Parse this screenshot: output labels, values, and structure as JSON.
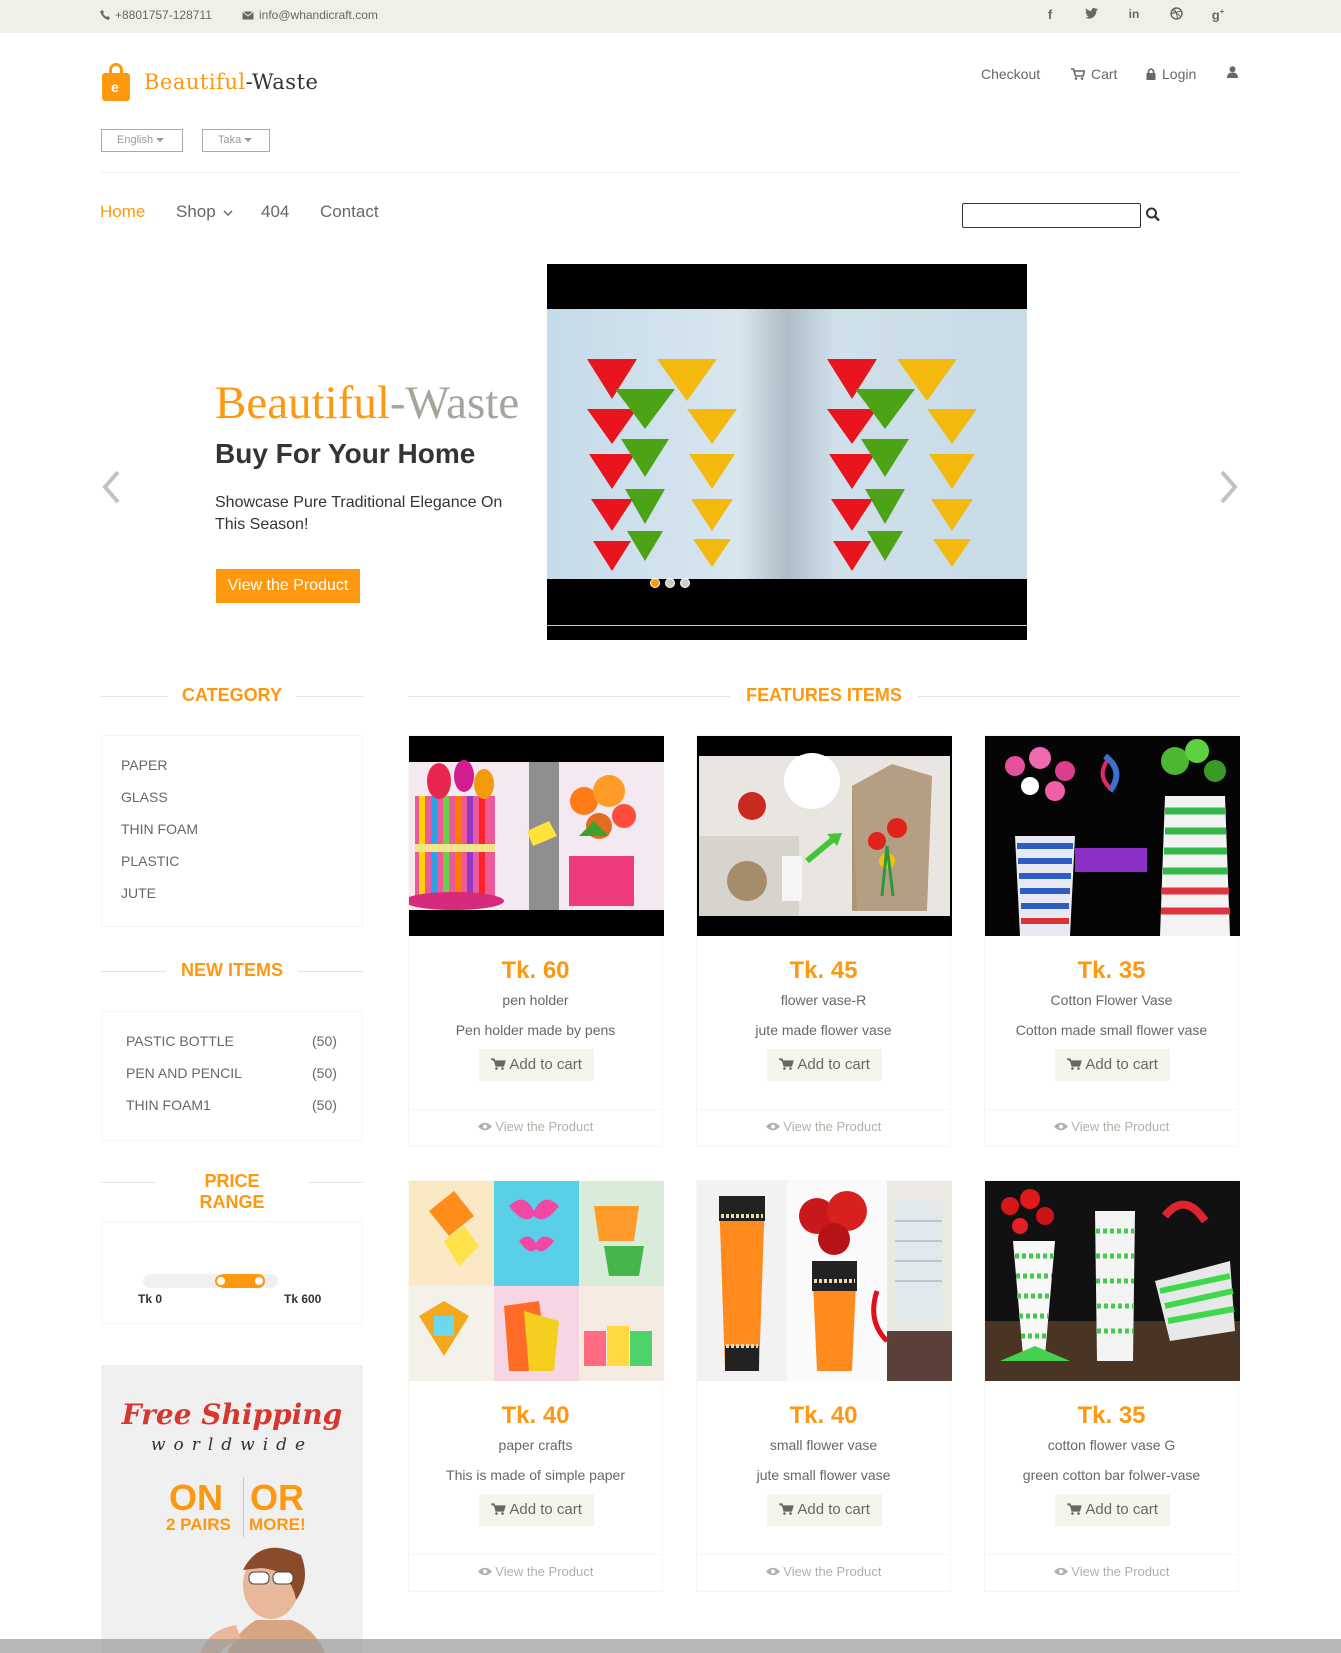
{
  "topbar": {
    "phone": "+8801757-128711",
    "email": "info@whandicraft.com",
    "social": [
      "facebook-icon",
      "twitter-icon",
      "linkedin-icon",
      "dribbble-icon",
      "google-plus-icon"
    ]
  },
  "brand": {
    "part1": "Beautiful",
    "part2": "-Waste",
    "color": "#fe980f"
  },
  "selectors": {
    "language": "English",
    "currency": "Taka"
  },
  "shop_menu": {
    "checkout": "Checkout",
    "cart": "Cart",
    "login": "Login"
  },
  "nav": {
    "home": "Home",
    "shop": "Shop",
    "notfound": "404",
    "contact": "Contact"
  },
  "search": {
    "placeholder": ""
  },
  "slider": {
    "title_part1": "Beautiful",
    "title_part2": "-Waste",
    "subtitle": "Buy For Your Home",
    "description": "Showcase Pure Traditional Elegance On This Season!",
    "button": "View the Product",
    "active_slide": 1,
    "slide_count": 3
  },
  "category": {
    "title": "CATEGORY",
    "items": [
      "PAPER",
      "GLASS",
      "THIN FOAM",
      "PLASTIC",
      "JUTE"
    ]
  },
  "new_items": {
    "title": "NEW ITEMS",
    "items": [
      {
        "label": "PASTIC BOTTLE",
        "count": "(50)"
      },
      {
        "label": "PEN AND PENCIL",
        "count": "(50)"
      },
      {
        "label": "THIN FOAM1",
        "count": "(50)"
      }
    ]
  },
  "price_range": {
    "title": "PRICE RANGE",
    "min_label": "Tk 0",
    "max_label": "Tk 600",
    "selected_start": 0.55,
    "selected_end": 0.9
  },
  "shipping_ad": {
    "line1": "Free Shipping",
    "line2": "worldwide",
    "on": "ON",
    "or": "OR",
    "pairs": "2 PAIRS",
    "more": "MORE!"
  },
  "features": {
    "title": "FEATURES ITEMS",
    "products": [
      {
        "price": "Tk. 60",
        "name": "pen holder",
        "desc": "Pen holder made by pens",
        "cart": "Add to cart",
        "view": "View the Product"
      },
      {
        "price": "Tk. 45",
        "name": "flower vase-R",
        "desc": "jute made flower vase",
        "cart": "Add to cart",
        "view": "View the Product"
      },
      {
        "price": "Tk. 35",
        "name": "Cotton Flower Vase",
        "desc": "Cotton made small flower vase",
        "cart": "Add to cart",
        "view": "View the Product"
      },
      {
        "price": "Tk. 40",
        "name": "paper crafts",
        "desc": "This is made of simple paper",
        "cart": "Add to cart",
        "view": "View the Product"
      },
      {
        "price": "Tk. 40",
        "name": "small flower vase",
        "desc": "jute small flower vase",
        "cart": "Add to cart",
        "view": "View the Product"
      },
      {
        "price": "Tk. 35",
        "name": "cotton flower vase G",
        "desc": "green cotton bar folwer-vase",
        "cart": "Add to cart",
        "view": "View the Product"
      }
    ]
  }
}
